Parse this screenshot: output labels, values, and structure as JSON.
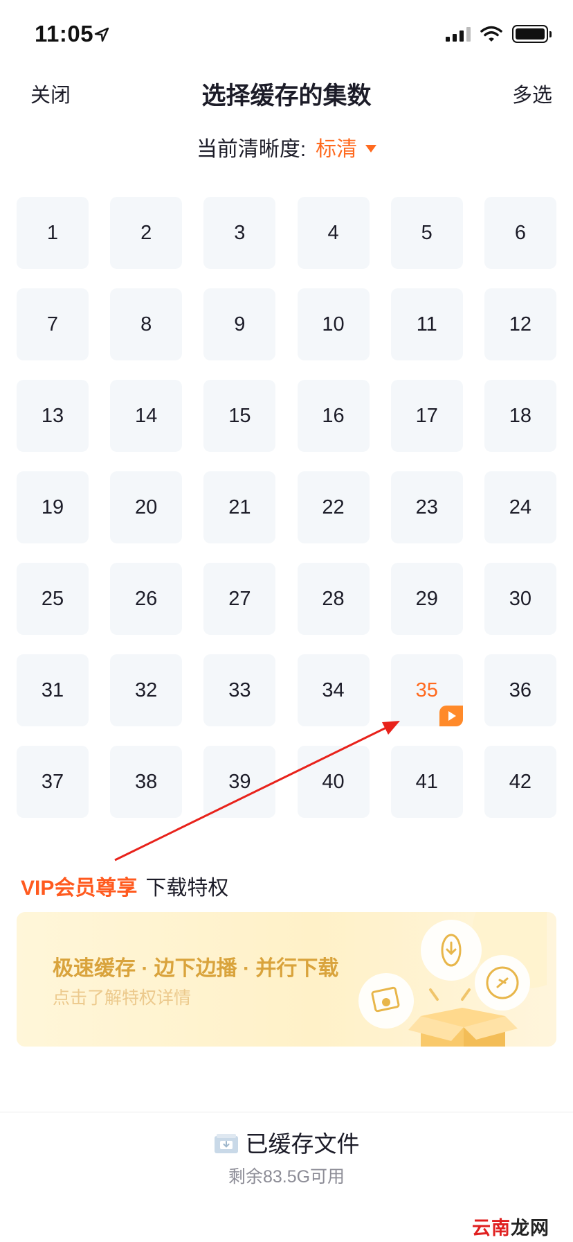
{
  "status_bar": {
    "time": "11:05"
  },
  "nav": {
    "close": "关闭",
    "title": "选择缓存的集数",
    "multi_select": "多选"
  },
  "quality": {
    "label": "当前清晰度:",
    "value": "标清"
  },
  "episodes": [
    "1",
    "2",
    "3",
    "4",
    "5",
    "6",
    "7",
    "8",
    "9",
    "10",
    "11",
    "12",
    "13",
    "14",
    "15",
    "16",
    "17",
    "18",
    "19",
    "20",
    "21",
    "22",
    "23",
    "24",
    "25",
    "26",
    "27",
    "28",
    "29",
    "30",
    "31",
    "32",
    "33",
    "34",
    "35",
    "36",
    "37",
    "38",
    "39",
    "40",
    "41",
    "42"
  ],
  "current_episode": "35",
  "vip": {
    "title_highlight": "VIP会员尊享",
    "title_rest": "下载特权",
    "banner_headline": "极速缓存 · 边下边播 · 并行下载",
    "banner_sub": "点击了解特权详情"
  },
  "cached": {
    "label": "已缓存文件",
    "storage": "剩余83.5G可用"
  },
  "watermark": {
    "part1": "云南",
    "part2": "龙网"
  },
  "colors": {
    "accent": "#ff6a1f",
    "tile_bg": "#f4f7fa",
    "vip_gold": "#d9a33c",
    "annotation_arrow": "#e8221b"
  }
}
